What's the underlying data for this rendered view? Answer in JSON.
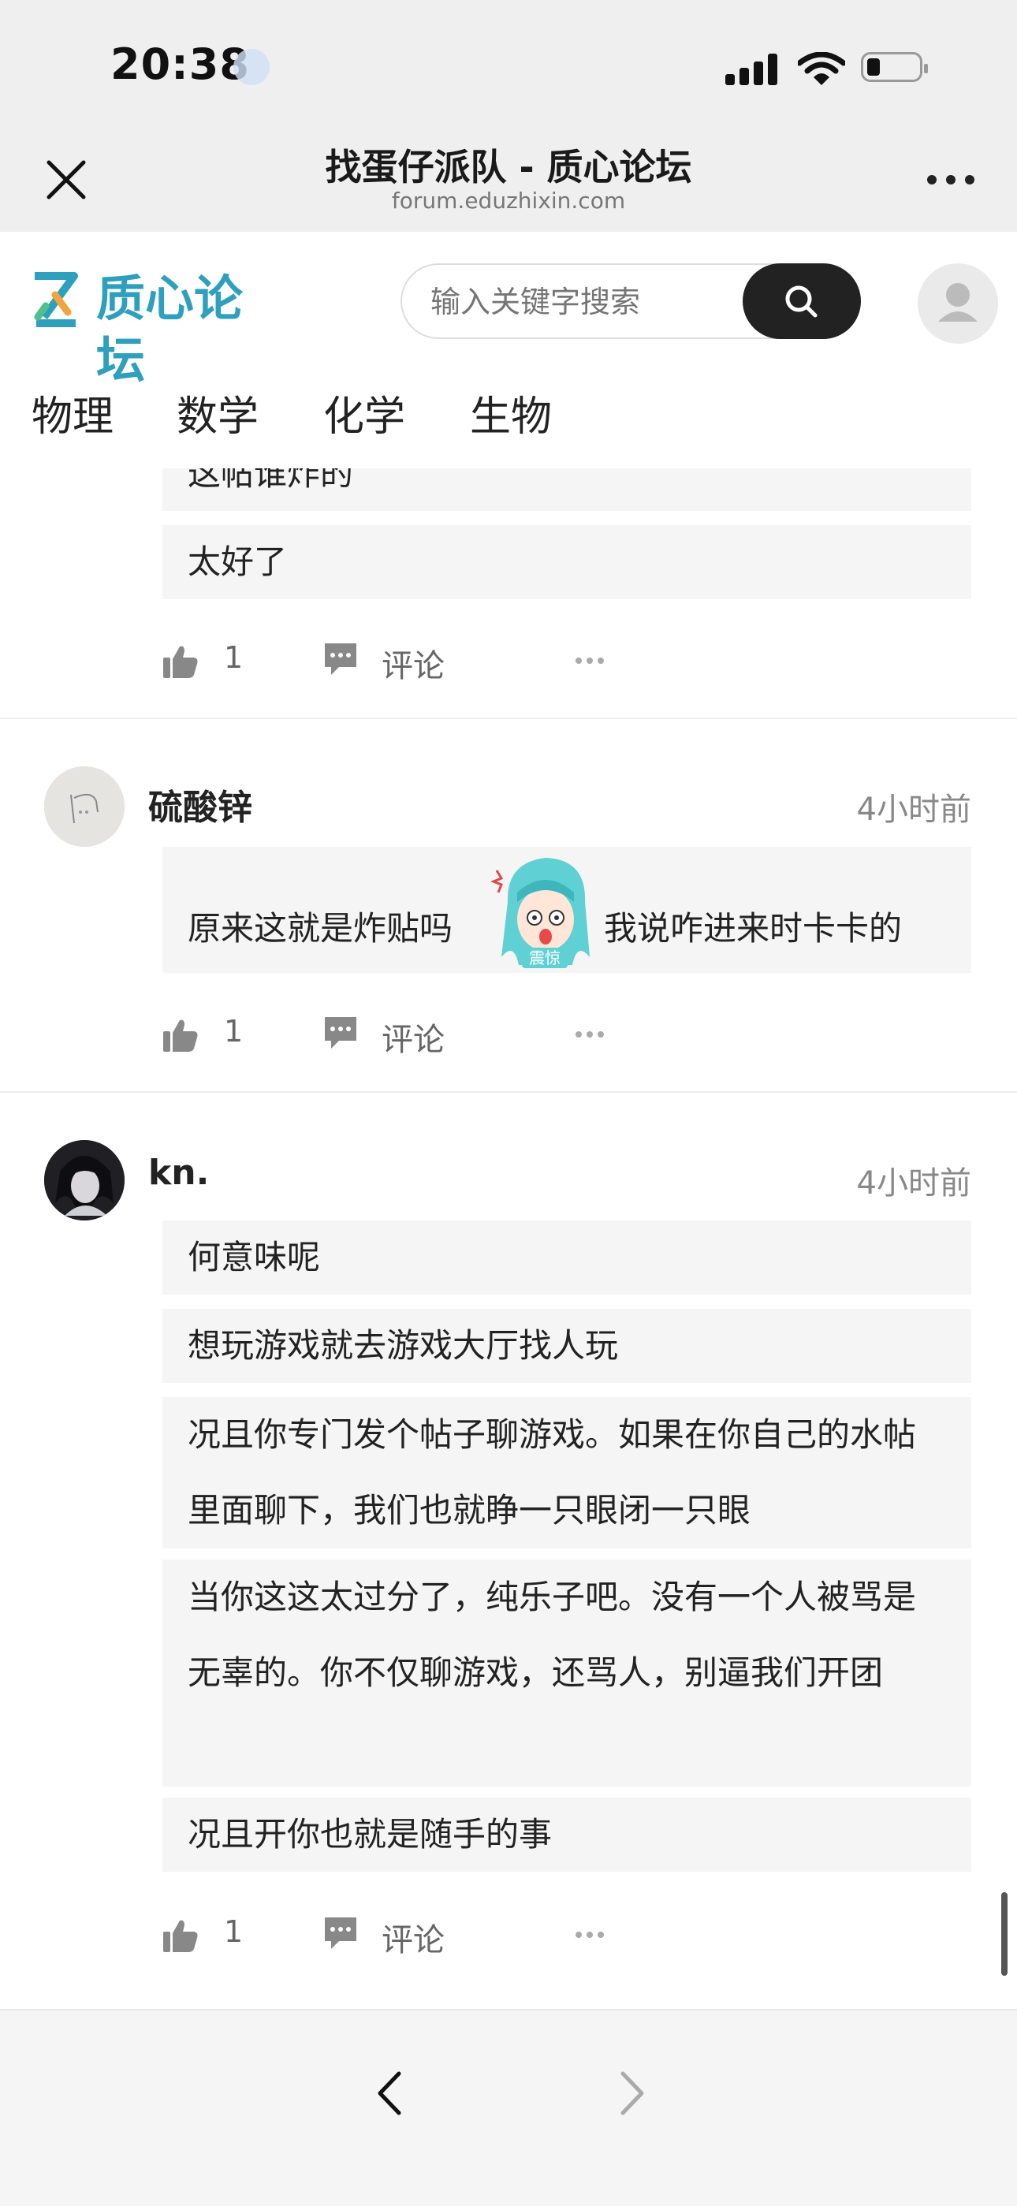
{
  "status_bar": {
    "time": "20:38"
  },
  "browser": {
    "title": "找蛋仔派队 - 质心论坛",
    "url": "forum.eduzhixin.com"
  },
  "site": {
    "logo_text": "质心论坛",
    "search_placeholder": "输入关键字搜索",
    "nav": [
      "物理",
      "数学",
      "化学",
      "生物"
    ]
  },
  "posts": [
    {
      "bubbles": [
        "这帖谁炸的",
        "太好了"
      ],
      "likes": "1",
      "comment_label": "评论"
    },
    {
      "username": "硫酸锌",
      "time": "4小时前",
      "bubble_text_before": "原来这就是炸贴吗",
      "sticker_label": "震惊",
      "bubble_text_after": "我说咋进来时卡卡的",
      "likes": "1",
      "comment_label": "评论"
    },
    {
      "username": "kn.",
      "time": "4小时前",
      "bubbles": [
        "何意味呢",
        "想玩游戏就去游戏大厅找人玩",
        "况且你专门发个帖子聊游戏。如果在你自己的水帖里面聊下，我们也就睁一只眼闭一只眼",
        "当你这这太过分了，纯乐子吧。没有一个人被骂是无辜的。你不仅聊游戏，还骂人，别逼我们开团",
        "况且开你也就是随手的事"
      ],
      "likes": "1",
      "comment_label": "评论"
    }
  ],
  "colors": {
    "brand": "#2e9fbd",
    "search_button": "#222222"
  }
}
